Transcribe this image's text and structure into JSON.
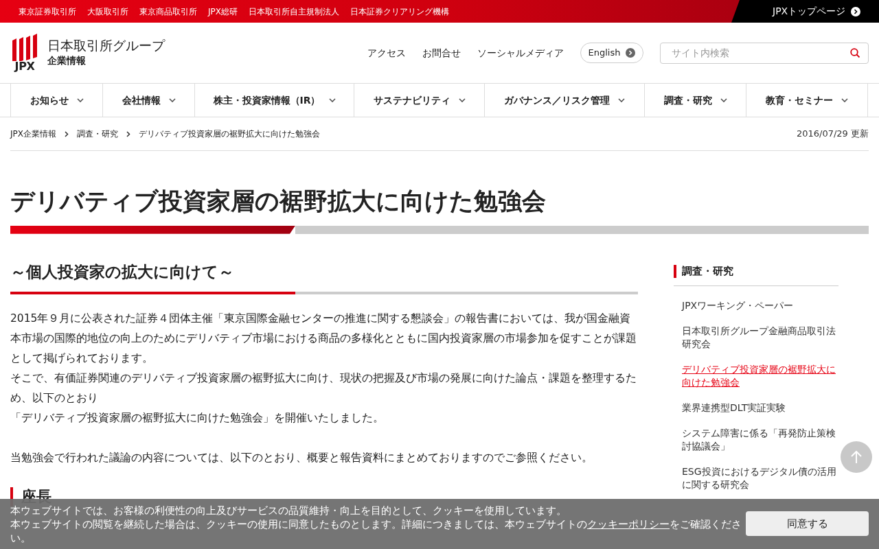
{
  "top_links": [
    "東京証券取引所",
    "大阪取引所",
    "東京商品取引所",
    "JPX総研",
    "日本取引所自主規制法人",
    "日本証券クリアリング機構"
  ],
  "top_page_link": "JPXトップページ",
  "logo": {
    "mark": "JPX",
    "name": "日本取引所グループ",
    "sub": "企業情報"
  },
  "utility_links": [
    "アクセス",
    "お問合せ",
    "ソーシャルメディア"
  ],
  "english_button": "English",
  "search": {
    "placeholder": "サイト内検索"
  },
  "nav": [
    "お知らせ",
    "会社情報",
    "株主・投資家情報（IR）",
    "サステナビリティ",
    "ガバナンス／リスク管理",
    "調査・研究",
    "教育・セミナー"
  ],
  "breadcrumb": [
    "JPX企業情報",
    "調査・研究",
    "デリバティブ投資家層の裾野拡大に向けた勉強会"
  ],
  "updated": "2016/07/29 更新",
  "page_title": "デリバティブ投資家層の裾野拡大に向けた勉強会",
  "section_heading": "～個人投資家の拡大に向けて～",
  "paragraphs": [
    "2015年９月に公表された証券４団体主催「東京国際金融センターの推進に関する懇談会」の報告書においては、我が国金融資本市場の国際的地位の向上のためにデリバティブ市場における商品の多様化とともに国内投資家層の市場参加を促すことが課題として掲げられております。",
    "そこで、有価証券関連のデリバティブ投資家層の裾野拡大に向け、現状の把握及び市場の発展に向けた論点・課題を整理するため、以下のとおり",
    "「デリバティブ投資家層の裾野拡大に向けた勉強会」を開催いたしました。",
    "当勉強会で行われた議論の内容については、以下のとおり、概要と報告資料にまとめておりますのでご参照ください。"
  ],
  "subheading": "座長",
  "sidebar": {
    "heading": "調査・研究",
    "items": [
      {
        "label": "JPXワーキング・ペーパー",
        "selected": false
      },
      {
        "label": "日本取引所グループ金融商品取引法研究会",
        "selected": false
      },
      {
        "label": "デリバティブ投資家層の裾野拡大に向けた勉強会",
        "selected": true
      },
      {
        "label": "業界連携型DLT実証実験",
        "selected": false
      },
      {
        "label": "システム障害に係る「再発防止策検討協議会」",
        "selected": false
      },
      {
        "label": "ESG投資におけるデジタル債の活用に関する研究会",
        "selected": false
      }
    ]
  },
  "cookie_banner": {
    "line_1": "本ウェブサイトでは、お客様の利便性の向上及びサービスの品質維持・向上を目的として、クッキーを使用しています。",
    "line_2": "本ウェブサイトの閲覧を継続した場合は、クッキーの使用に同意したものとします。詳細につきましては、本ウェブサイトの",
    "link": "クッキーポリシー",
    "line_2_end": "をご確認ください。",
    "button": "同意する"
  }
}
